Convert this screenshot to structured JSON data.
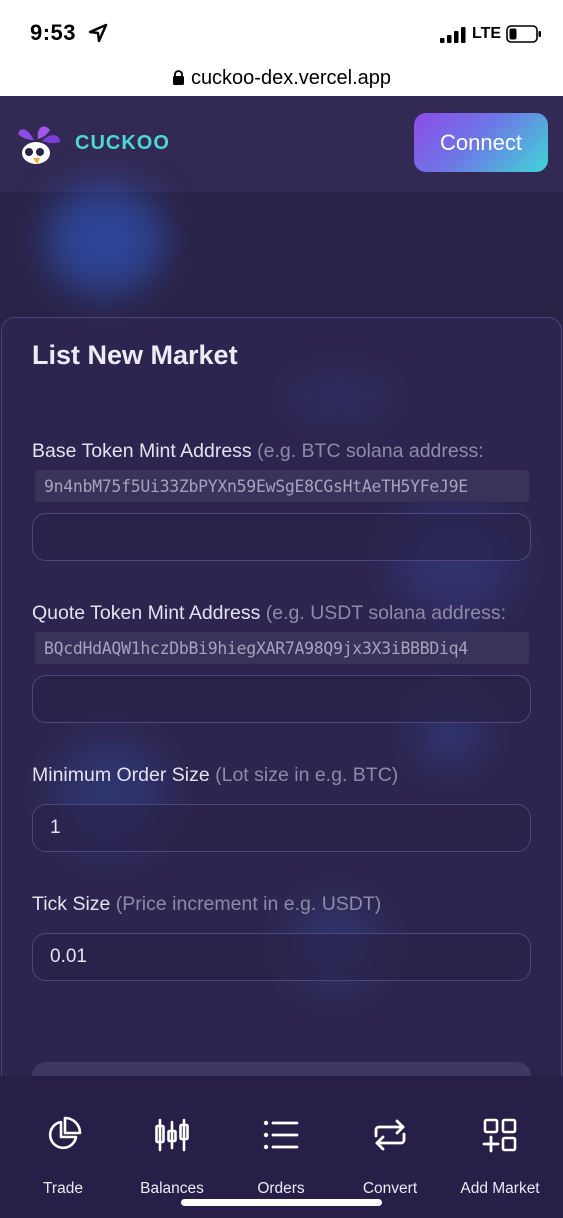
{
  "status_bar": {
    "time": "9:53",
    "network": "LTE",
    "icons": [
      "location-arrow-icon",
      "signal-bars-icon",
      "battery-icon"
    ]
  },
  "browser": {
    "url": "cuckoo-dex.vercel.app",
    "icon": "lock-icon"
  },
  "header": {
    "brand": "CUCKOO",
    "connect_label": "Connect",
    "logo_icon": "cuckoo-logo-icon"
  },
  "form": {
    "title": "List New Market",
    "base_token": {
      "label": "Base Token Mint Address",
      "hint": "(e.g. BTC solana address:",
      "example": "9n4nbM75f5Ui33ZbPYXn59EwSgE8CGsHtAeTH5YFeJ9E",
      "value": ""
    },
    "quote_token": {
      "label": "Quote Token Mint Address",
      "hint": "(e.g. USDT solana address:",
      "example": "BQcdHdAQW1hczDbBi9hiegXAR7A98Q9jx3X3iBBBDiq4",
      "value": ""
    },
    "min_order": {
      "label": "Minimum Order Size",
      "hint": "(Lot size in e.g. BTC)",
      "value": "1"
    },
    "tick_size": {
      "label": "Tick Size",
      "hint": "(Price increment in e.g. USDT)",
      "value": "0.01"
    }
  },
  "nav": {
    "items": [
      {
        "label": "Trade",
        "icon": "pie-chart-icon"
      },
      {
        "label": "Balances",
        "icon": "candlestick-icon"
      },
      {
        "label": "Orders",
        "icon": "list-icon"
      },
      {
        "label": "Convert",
        "icon": "repeat-arrows-icon"
      },
      {
        "label": "Add Market",
        "icon": "add-grid-icon"
      }
    ]
  },
  "colors": {
    "background": "#2a2348",
    "header": "#322a55",
    "brand_text": "#4fd6d6",
    "connect_gradient": [
      "#8d4ce8",
      "#3fd6d8"
    ],
    "nav_background": "#271f47"
  }
}
